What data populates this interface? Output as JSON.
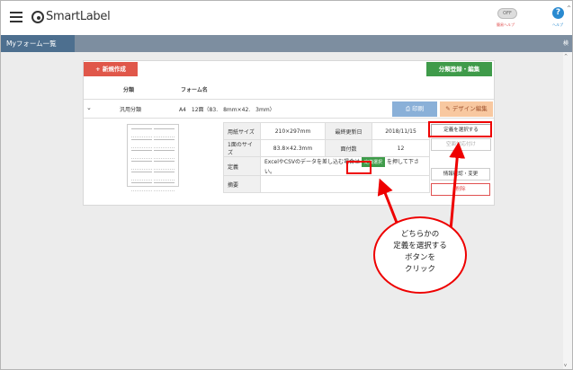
{
  "header": {
    "app_name": "SmartLabel",
    "toggle_state": "OFF",
    "toggle_label": "簡易ヘルプ",
    "help_symbol": "?",
    "help_label": "ヘルプ",
    "help_caret": "^"
  },
  "nav": {
    "active_tab": "Myフォーム一覧",
    "right_text": "検"
  },
  "toolbar": {
    "new_label": "+ 新規作成",
    "category_label": "分類登録・編集"
  },
  "table": {
    "headers": [
      "分類",
      "フォーム名"
    ],
    "row": {
      "category": "汎用分類",
      "form_name": "A4　12面（83.　8mm×42.　3mm）"
    },
    "print_label": "印刷",
    "design_label": "デザイン編集"
  },
  "detail": {
    "paper_size_label": "用紙サイズ",
    "paper_size_value": "210×297mm",
    "last_update_label": "最終更新日",
    "last_update_value": "2018/11/15",
    "face_size_label": "1面のサイズ",
    "face_size_value": "83.8×42.3mm",
    "face_count_label": "面付数",
    "face_count_value": "12",
    "definition_label": "定義",
    "definition_text_a": "ExcelやCSVのデータを差し込む場合は",
    "definition_btn": "定義選択",
    "definition_text_b": "を押して下さい。",
    "summary_label": "摘要",
    "summary_value": ""
  },
  "side_buttons": {
    "select_def": "定義を選択する",
    "blank_pos": "空面対応付け",
    "info_edit": "情報確認・変更",
    "delete": "削除"
  },
  "callout": {
    "lines": [
      "どちらかの",
      "定義を選択する",
      "ボタンを",
      "クリック"
    ]
  },
  "scrollbar": {
    "up": "^",
    "down": "v"
  },
  "colors": {
    "nav_active": "#4d6f8f",
    "new_button": "#e0574a",
    "category_button": "#3f9b4a",
    "highlight": "#ee0000"
  }
}
